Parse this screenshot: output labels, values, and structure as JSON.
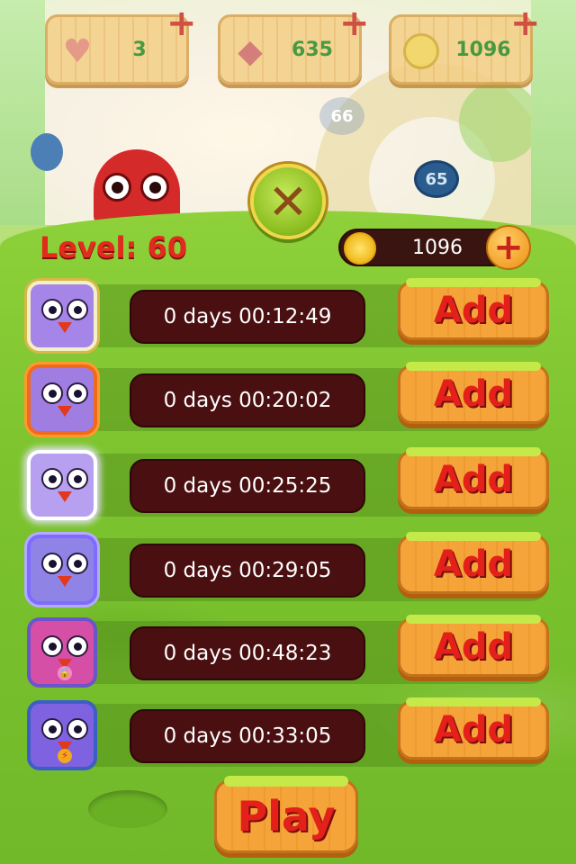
{
  "resources": {
    "lives": "3",
    "gems": "635",
    "coins": "1096"
  },
  "map_nodes": {
    "node_a": "66",
    "node_b": "65"
  },
  "panel": {
    "close_symbol": "✕",
    "level_label": "Level: 60",
    "coin_balance": "1096",
    "coin_add_symbol": "+",
    "play_label": "Play"
  },
  "boosters": [
    {
      "icon": "frost-frame-bird-icon",
      "timer": "0 days 00:12:49",
      "add_label": "Add"
    },
    {
      "icon": "fire-frame-bird-icon",
      "timer": "0 days 00:20:02",
      "add_label": "Add"
    },
    {
      "icon": "lightning-bird-icon",
      "timer": "0 days 00:25:25",
      "add_label": "Add"
    },
    {
      "icon": "blue-frame-bird-icon",
      "timer": "0 days 00:29:05",
      "add_label": "Add"
    },
    {
      "icon": "lock-bird-icon",
      "timer": "0 days 00:48:23",
      "add_label": "Add"
    },
    {
      "icon": "alarm-clock-bird-icon",
      "timer": "0 days 00:33:05",
      "add_label": "Add"
    }
  ],
  "colors": {
    "panel_green": "#7cc32e",
    "timer_bg": "#4a0f10",
    "button_orange": "#f5a43a",
    "label_red": "#e22a1d"
  }
}
